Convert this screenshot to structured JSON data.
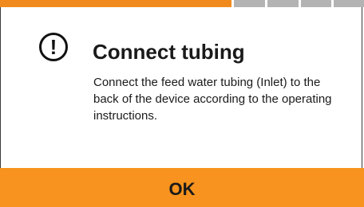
{
  "progress": {
    "completed_fraction": 0.65,
    "segments": [
      "done",
      "pending",
      "pending",
      "pending",
      "pending"
    ],
    "colors": {
      "done": "#f08a1d",
      "pending": "#b3b3b3"
    }
  },
  "dialog": {
    "icon": "exclamation-circle-icon",
    "icon_glyph": "!",
    "title": "Connect tubing",
    "message": "Connect the feed water tubing (Inlet) to the back of the device according to the operating instructions."
  },
  "actions": {
    "ok_label": "OK",
    "ok_color": "#f7931e"
  }
}
